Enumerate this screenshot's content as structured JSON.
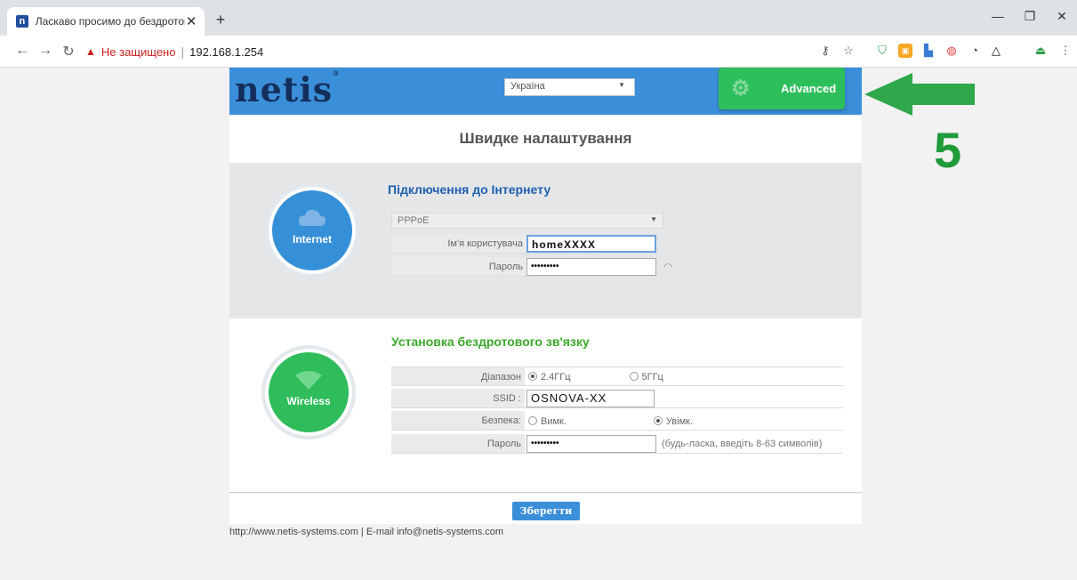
{
  "browser": {
    "tab_title": "Ласкаво просимо до бездротов",
    "tab_favicon": "n",
    "url_warning": "Не защищено",
    "url": "192.168.1.254"
  },
  "header": {
    "logo": "netis",
    "country_select": "Україна",
    "advanced_button": "Advanced"
  },
  "annotation": {
    "step_number": "5",
    "arrow_color": "#2ea84a"
  },
  "page_title": "Швидке налаштування",
  "internet": {
    "circle_label": "Internet",
    "section_title": "Підключення до Інтернету",
    "connection_type": "PPPoE",
    "username_label": "Ім'я користувача",
    "username_value": "homeXXXX",
    "password_label": "Пароль",
    "password_value": "•••••••••"
  },
  "wireless": {
    "circle_label": "Wireless",
    "section_title": "Установка бездротового зв'язку",
    "band_label": "Діапазон",
    "band_24": "2.4ГГц",
    "band_5": "5ГГц",
    "ssid_label": "SSID :",
    "ssid_value": "OSNOVA-XX",
    "security_label": "Безпека:",
    "security_off": "Вимк.",
    "security_on": "Увімк.",
    "password_label": "Пароль",
    "password_value": "•••••••••",
    "password_hint": "(будь-ласка, введіть 8-63 символів)"
  },
  "save_button": "Зберегти",
  "footer": "http://www.netis-systems.com | E-mail info@netis-systems.com",
  "colors": {
    "header_blue": "#3b8fd9",
    "advanced_green": "#2dbf5b",
    "internet_circle": "#3690d8",
    "wireless_circle": "#2ebd5a",
    "internet_title": "#1f5fae",
    "wireless_title": "#3aa829"
  }
}
